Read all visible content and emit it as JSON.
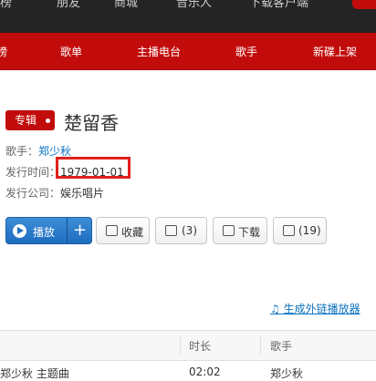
{
  "top_nav": [
    "榜",
    "朋友",
    "商城",
    "音乐人",
    "下载客户端"
  ],
  "sub_nav": [
    "榜",
    "歌单",
    "主播电台",
    "歌手",
    "新碟上架"
  ],
  "album": {
    "tag": "专辑",
    "title": "楚留香",
    "singer_label": "歌手：",
    "singer": "郑少秋",
    "release_label": "发行时间：",
    "release_date": "1979-01-01",
    "company_label": "发行公司：",
    "company": "娱乐唱片"
  },
  "actions": {
    "play": "播放",
    "add": "+",
    "collect": "收藏",
    "share": "(3)",
    "download": "下载",
    "comment": "(19)"
  },
  "external_link": "生成外链播放器",
  "table": {
    "headers": [
      "时长",
      "歌手"
    ],
    "rows": [
      {
        "title": "郑少秋 主题曲",
        "duration": "02:02",
        "artist": "郑少秋"
      }
    ]
  }
}
